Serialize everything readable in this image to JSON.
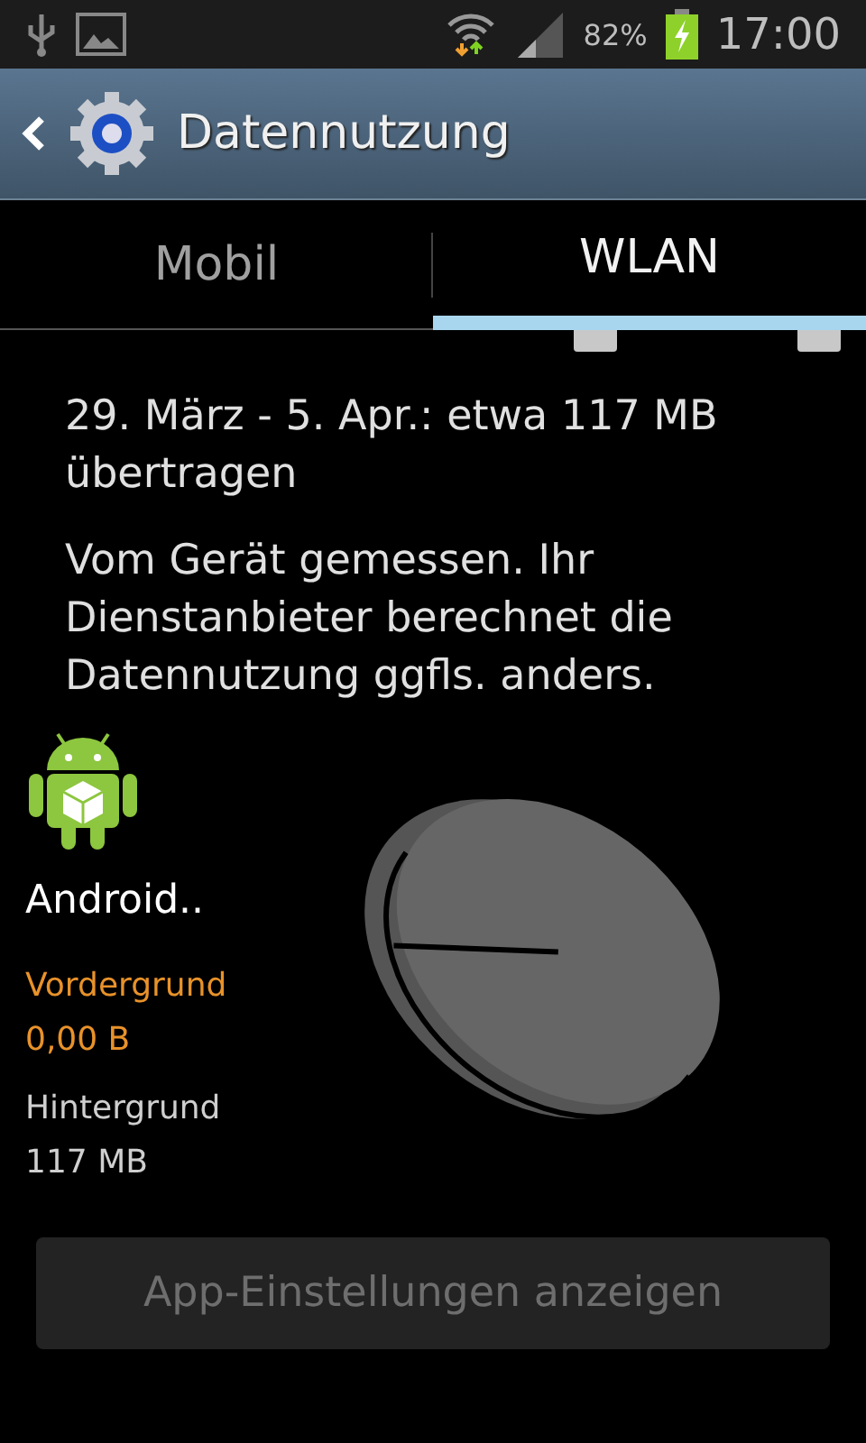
{
  "status_bar": {
    "battery": "82%",
    "time": "17:00"
  },
  "action_bar": {
    "title": "Datennutzung"
  },
  "tabs": [
    {
      "label": "Mobil",
      "selected": false
    },
    {
      "label": "WLAN",
      "selected": true
    }
  ],
  "summary": "29. März - 5. Apr.: etwa 117 MB übertragen",
  "note": "Vom Gerät gemessen. Ihr Dienstanbieter berechnet die Datennutzung ggfls. anders.",
  "app": {
    "name": "Android..",
    "foreground_label": "Vordergrund",
    "foreground_value": "0,00 B",
    "background_label": "Hintergrund",
    "background_value": "117 MB"
  },
  "button": {
    "label": "App-Einstellungen anzeigen",
    "disabled": true
  }
}
